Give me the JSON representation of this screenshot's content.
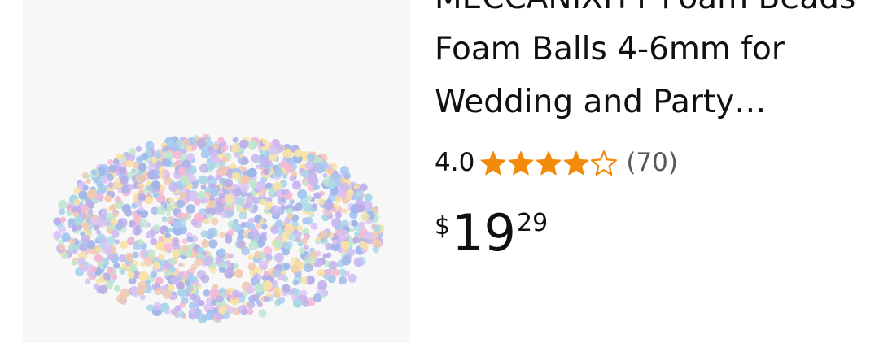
{
  "product": {
    "title_line_1_partial": "MECCANIXITY Foam Beads",
    "title_line_2": "Foam Balls 4-6mm for",
    "title_line_3": "Wedding and Party…",
    "rating_value": "4.0",
    "rating": 4.0,
    "rating_max": 5,
    "review_count": "(70)",
    "price_symbol": "$",
    "price_whole": "19",
    "price_fraction": "29",
    "image_icon": "foam-beads-pile-image"
  },
  "colors": {
    "star_filled": "#f28b0c",
    "star_outline": "#f28b0c",
    "text_primary": "#0f1111",
    "text_secondary": "#565959",
    "image_background": "#f7f7f7"
  }
}
